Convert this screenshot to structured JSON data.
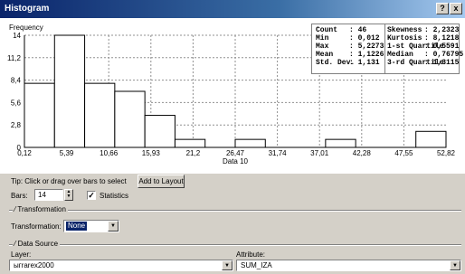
{
  "window": {
    "title": "Histogram",
    "help_label": "?",
    "close_label": "x"
  },
  "stats": {
    "left": [
      {
        "label": "Count",
        "value": ": 46"
      },
      {
        "label": "Min",
        "value": ": 0,012"
      },
      {
        "label": "Max",
        "value": ": 5,2273"
      },
      {
        "label": "Mean",
        "value": ": 1,1226"
      },
      {
        "label": "Std. Dev.",
        "value": ": 1,131"
      }
    ],
    "right": [
      {
        "label": "Skewness",
        "value": ": 2,2323"
      },
      {
        "label": "Kurtosis",
        "value": ": 8,1218"
      },
      {
        "label": "1-st Quartile",
        "value": ": 0,5591"
      },
      {
        "label": "Median",
        "value": ": 0,76795"
      },
      {
        "label": "3-rd Quartile",
        "value": ": 1,3115"
      }
    ]
  },
  "chart_data": {
    "type": "bar",
    "ylabel": "Frequency",
    "xlabel": "Data 10",
    "y_ticks": [
      "0",
      "2,8",
      "5,6",
      "8,4",
      "11,2",
      "14"
    ],
    "x_ticks": [
      "0,12",
      "5,39",
      "10,66",
      "15,93",
      "21,2",
      "26,47",
      "31,74",
      "37,01",
      "42,28",
      "47,55",
      "52,82"
    ],
    "ylim": [
      0,
      14
    ],
    "bins": 14,
    "values": [
      8,
      14,
      8,
      7,
      4,
      1,
      0,
      1,
      0,
      0,
      1,
      0,
      0,
      2
    ],
    "grid": true
  },
  "controls": {
    "tip_text": "Tip:  Click or drag over bars to select",
    "add_to_layout": "Add to Layout",
    "bars_label": "Bars:",
    "bars_value": "14",
    "statistics_label": "Statistics",
    "statistics_checked": true,
    "transformation_group": "Transformation",
    "transformation_label": "Transformation:",
    "transformation_value": "None",
    "data_source_group": "Data Source",
    "layer_label": "Layer:",
    "layer_value": "ыгrarex2000",
    "attribute_label": "Attribute:",
    "attribute_value": "SUM_IZA"
  }
}
